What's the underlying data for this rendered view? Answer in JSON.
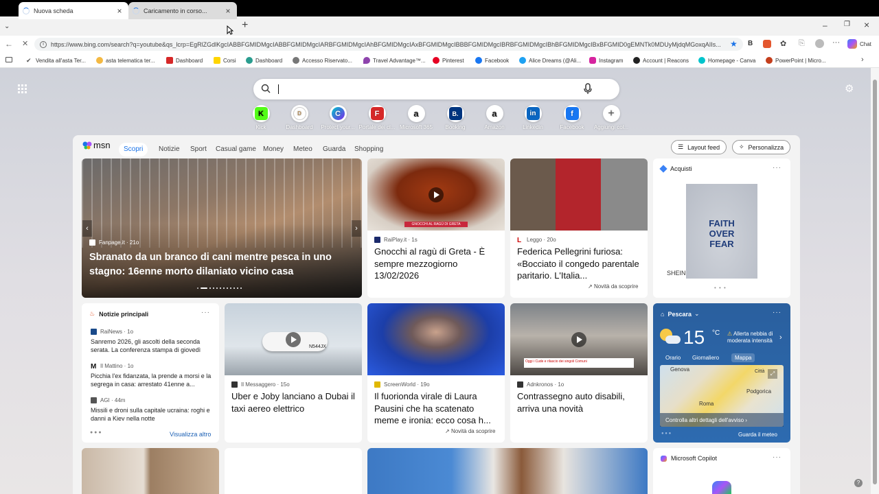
{
  "tabs": [
    {
      "title": "Nuova scheda"
    },
    {
      "title": "Caricamento in corso..."
    }
  ],
  "address": {
    "url": "https://www.bing.com/search?q=youtube&qs_lcrp=EgRlZGdlKgcIABBFGMIDMgcIABBFGMIDMgcIARBFGMIDMgcIAhBFGMIDMgcIAxBFGMIDMgcIBBBFGMIDMgcIBRBFGMIDMgcIBhBFGMIDMgcIBxBFGMID0gEMNTk0MDUyMjdqMGoxqAIIs..."
  },
  "toolbar": {
    "chat_label": "Chat"
  },
  "favorites": [
    {
      "label": "Vendita all'asta Ter..."
    },
    {
      "label": "asta telematica ter..."
    },
    {
      "label": "Dashboard"
    },
    {
      "label": "Corsi"
    },
    {
      "label": "Dashboard"
    },
    {
      "label": "Accesso Riservato..."
    },
    {
      "label": "Travel Advantage™..."
    },
    {
      "label": "Pinterest"
    },
    {
      "label": "Facebook"
    },
    {
      "label": "Alice Dreams (@Ali..."
    },
    {
      "label": "Instagram"
    },
    {
      "label": "Account | Reacons"
    },
    {
      "label": "Homepage - Canva"
    },
    {
      "label": "PowerPoint | Micro..."
    }
  ],
  "quicklinks": [
    {
      "label": "Kick",
      "letter": "K"
    },
    {
      "label": "Dashboard",
      "letter": "D"
    },
    {
      "label": "Protect your...",
      "letter": "C"
    },
    {
      "label": "Portale dei cl...",
      "letter": "F"
    },
    {
      "label": "Microsoft 365",
      "letter": "a"
    },
    {
      "label": "Booking",
      "letter": "B."
    },
    {
      "label": "Amazon",
      "letter": "a"
    },
    {
      "label": "Linkedin",
      "letter": "in"
    },
    {
      "label": "Facebook",
      "letter": "f"
    },
    {
      "label": "Aggiungi col...",
      "letter": "+"
    }
  ],
  "msn": {
    "logo": "msn",
    "nav": [
      "Scopri",
      "Notizie",
      "Sport",
      "Casual game",
      "Money",
      "Meteo",
      "Guarda",
      "Shopping"
    ],
    "layout_btn": "Layout feed",
    "personalize_btn": "Personalizza"
  },
  "hero": {
    "source": "Fanpage.it · 21o",
    "title": "Sbranato da un branco di cani mentre pesca in uno stagno: 16enne morto dilaniato vicino casa"
  },
  "card1": {
    "source": "RaiPlay.it · 1s",
    "title": "Gnocchi al ragù di Greta - È sempre mezzogiorno 13/02/2026",
    "caption": "GNOCCHI AL RAGÙ DI GRETA"
  },
  "card2": {
    "source": "Leggo · 20o",
    "title": "Federica Pellegrini furiosa: «Bocciato il congedo parentale paritario. L'Italia...",
    "tag": "Novità da scoprire"
  },
  "shop": {
    "title": "Acquisti",
    "brand": "SHEIN",
    "print": "FAITH OVER FEAR"
  },
  "top": {
    "title": "Notizie principali",
    "more": "Visualizza altro",
    "items": [
      {
        "source": "RaiNews · 1o",
        "text": "Sanremo 2026, gli ascolti della seconda serata. La conferenza stampa di giovedì"
      },
      {
        "source": "Il Mattino · 1o",
        "text": "Picchia l'ex fidanzata, la prende a morsi e la segrega in casa: arrestato 41enne a..."
      },
      {
        "source": "AGI · 44m",
        "text": "Missili e droni sulla capitale ucraina: roghi e danni a Kiev nella notte"
      }
    ]
  },
  "card3": {
    "source": "Il Messaggero · 15o",
    "title": "Uber e Joby lanciano a Dubai il taxi aereo elettrico",
    "plate": "N544JX"
  },
  "card4": {
    "source": "ScreenWorld · 19o",
    "title": "Il fuorionda virale di Laura Pausini che ha scatenato meme e ironia: ecco cosa h...",
    "tag": "Novità da scoprire"
  },
  "card5": {
    "source": "Adnkronos · 1o",
    "title": "Contrassegno auto disabili, arriva una novità",
    "caption": "Oggi i Cude e rilascio dei singoli Comuni"
  },
  "weather": {
    "city": "Pescara",
    "temp": "15",
    "unit": "°C",
    "alert": "Allerta nebbia di moderata intensità",
    "tabs": [
      "Orario",
      "Giornaliero",
      "Mappa"
    ],
    "map_labels": [
      "Genova",
      "Città",
      "Podgorica",
      "Roma"
    ],
    "more": "Controlla altri dettagli dell'avviso",
    "link": "Guarda il meteo"
  },
  "copilot": {
    "title": "Microsoft Copilot"
  }
}
